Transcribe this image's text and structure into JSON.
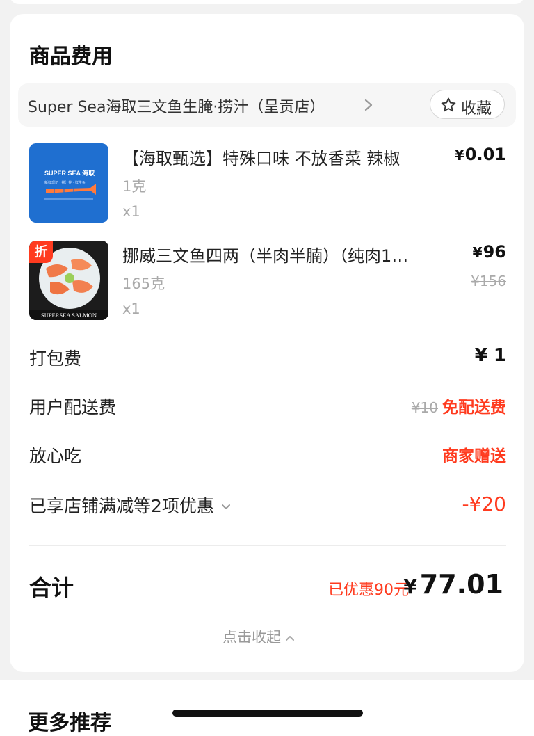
{
  "section_title": "商品费用",
  "store": {
    "name": "Super Sea海取三文鱼生腌·捞汁（呈贡店）",
    "favorite_label": "收藏"
  },
  "items": [
    {
      "name": "【海取甄选】特殊口味 不放香菜 辣椒",
      "spec": "1克",
      "qty": "x1",
      "price_symbol": "¥",
      "price": "0.01",
      "image_brand": "SUPER SEA 海取",
      "image_sub": "新鲜现切 · 捞汁拌 · 鲜生鱼"
    },
    {
      "name": "挪威三文鱼四两（半肉半腩）（纯肉1…",
      "spec": "165克",
      "qty": "x1",
      "price_symbol": "¥",
      "price": "96",
      "old_price": "¥156",
      "badge": "折",
      "image_caption": "SUPERSEA SALMON"
    }
  ],
  "fees": {
    "packing_label": "打包费",
    "packing_value": "¥ 1",
    "delivery_label": "用户配送费",
    "delivery_old": "¥10",
    "delivery_value": "免配送费",
    "assured_label": "放心吃",
    "assured_value": "商家赠送",
    "discount_label": "已享店铺满减等2项优惠",
    "discount_value": "-¥20"
  },
  "total": {
    "label": "合计",
    "saved": "已优惠90元",
    "symbol": "¥",
    "value": "77.01"
  },
  "collapse_label": "点击收起",
  "more_title": "更多推荐",
  "colors": {
    "accent_red": "#ff3b1f",
    "item1_bg": "#1f6fd0"
  }
}
